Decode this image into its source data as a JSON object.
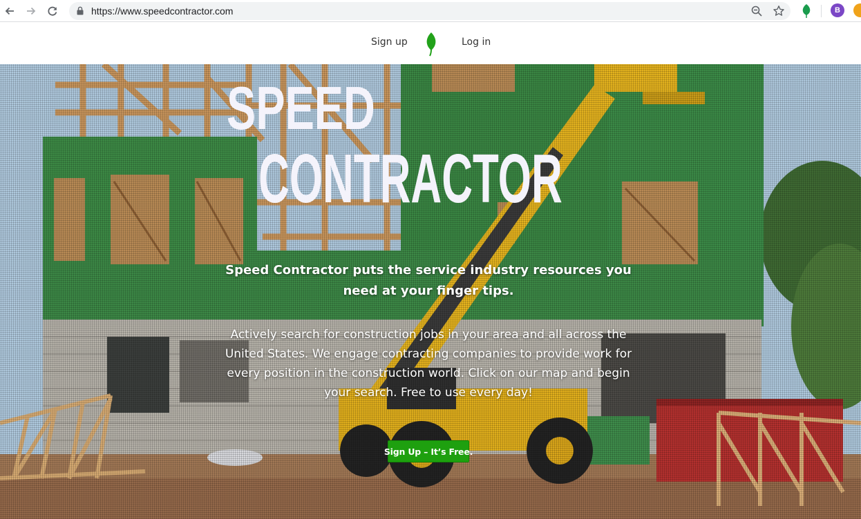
{
  "browser": {
    "url": "https://www.speedcontractor.com",
    "profile_initial": "B",
    "icons": {
      "back": "arrow-left-icon",
      "forward": "arrow-right-icon",
      "reload": "reload-icon",
      "lock": "lock-icon",
      "zoom": "zoom-icon",
      "bookmark": "star-icon",
      "extension": "green-leaf-extension-icon",
      "extension2": "orange-extension-icon"
    },
    "colors": {
      "avatar": "#7b47c6",
      "extension_green": "#1a9c4d",
      "extension_orange": "#f0a31a"
    }
  },
  "header": {
    "signup_label": "Sign up",
    "login_label": "Log in",
    "logo_icon": "green-leaf-logo-icon",
    "logo_color": "#22a21a"
  },
  "hero": {
    "title_line1": "SPEED",
    "title_line2": "CONTRACTOR",
    "tagline": "Speed Contractor puts the service industry resources you need at your finger tips.",
    "description": "Actively search for construction jobs in your area and all across the United States. We engage contracting companies to provide work for every position in the construction world. Click on our map and begin your search. Free to use every day!",
    "cta_label": "Sign Up – It’s Free.",
    "cta_color": "#1ea00f",
    "background": "construction-site-photo"
  }
}
